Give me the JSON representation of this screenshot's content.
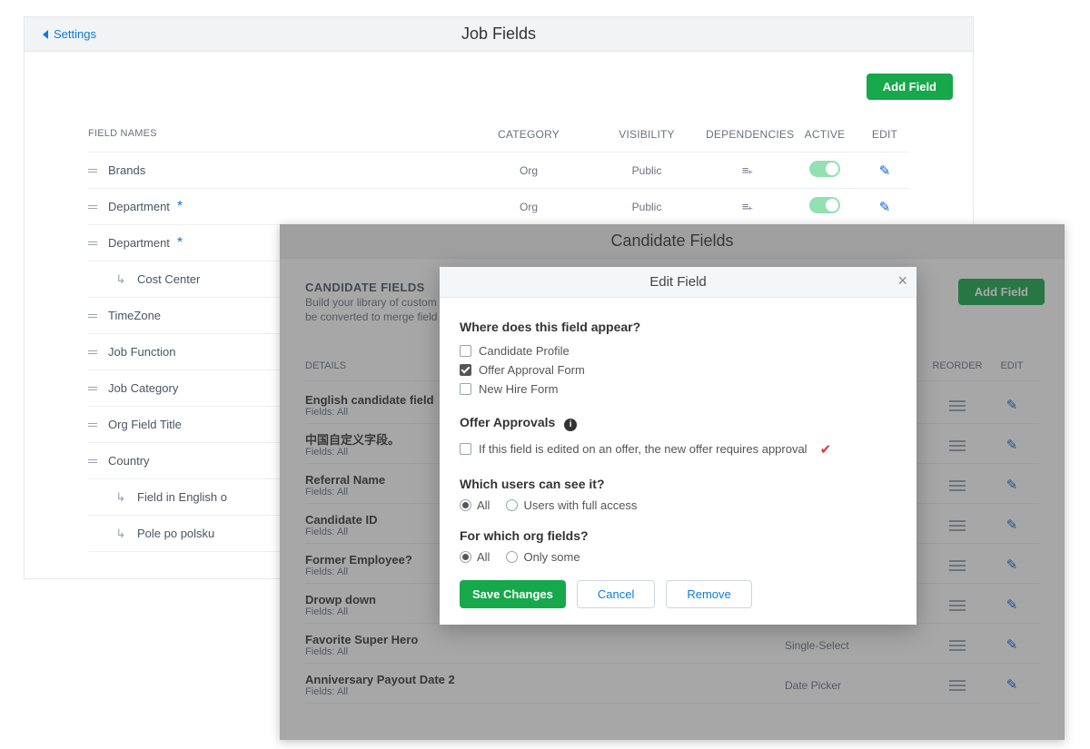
{
  "back": {
    "settings": "Settings",
    "title": "Job Fields",
    "add": "Add Field",
    "headers": {
      "names": "FIELD NAMES",
      "category": "CATEGORY",
      "visibility": "VISIBILITY",
      "deps": "DEPENDENCIES",
      "active": "ACTIVE",
      "edit": "EDIT"
    },
    "rows": [
      {
        "name": "Brands",
        "category": "Org",
        "visibility": "Public",
        "indent": 0,
        "star": false,
        "full": true
      },
      {
        "name": "Department",
        "category": "Org",
        "visibility": "Public",
        "indent": 0,
        "star": true,
        "full": true
      },
      {
        "name": "Department",
        "indent": 0,
        "star": true,
        "full": false
      },
      {
        "name": "Cost Center",
        "indent": 1,
        "star": false,
        "full": false
      },
      {
        "name": "TimeZone",
        "indent": 0,
        "star": false,
        "full": false
      },
      {
        "name": "Job Function",
        "indent": 0,
        "star": false,
        "full": false
      },
      {
        "name": "Job Category",
        "indent": 0,
        "star": false,
        "full": false
      },
      {
        "name": "Org Field Title",
        "indent": 0,
        "star": false,
        "full": false
      },
      {
        "name": "Country",
        "indent": 0,
        "star": false,
        "full": false
      },
      {
        "name": "Field in English o",
        "indent": 1,
        "star": false,
        "full": false
      },
      {
        "name": "Pole po polsku",
        "indent": 1,
        "star": false,
        "full": false
      }
    ]
  },
  "front": {
    "title": "Candidate Fields",
    "introTitle": "CANDIDATE FIELDS",
    "introSub1": "Build your library of custom",
    "introSub2": "be converted to merge field",
    "add": "Add Field",
    "cols": {
      "details": "DETAILS",
      "reorder": "REORDER",
      "edit": "EDIT"
    },
    "fieldsLabel": "Fields: All",
    "items": [
      {
        "name": "English candidate field",
        "type": ""
      },
      {
        "name": "中国自定义字段。",
        "type": ""
      },
      {
        "name": "Referral Name",
        "type": ""
      },
      {
        "name": "Candidate ID",
        "type": ""
      },
      {
        "name": "Former Employee?",
        "type": ""
      },
      {
        "name": "Drowp down",
        "type": ""
      },
      {
        "name": "Favorite Super Hero",
        "type": "Single-Select"
      },
      {
        "name": "Anniversary Payout Date 2",
        "type": "Date Picker"
      }
    ]
  },
  "modal": {
    "title": "Edit Field",
    "q1": "Where does this field appear?",
    "opts": [
      {
        "label": "Candidate Profile",
        "checked": false
      },
      {
        "label": "Offer Approval Form",
        "checked": true
      },
      {
        "label": "New Hire Form",
        "checked": false
      }
    ],
    "q2": "Offer Approvals",
    "appLabel": "If this field is edited on an offer, the new offer requires approval",
    "q3": "Which users can see it?",
    "r3a": "All",
    "r3b": "Users with full access",
    "q4": "For which org fields?",
    "r4a": "All",
    "r4b": "Only some",
    "save": "Save Changes",
    "cancel": "Cancel",
    "remove": "Remove"
  }
}
